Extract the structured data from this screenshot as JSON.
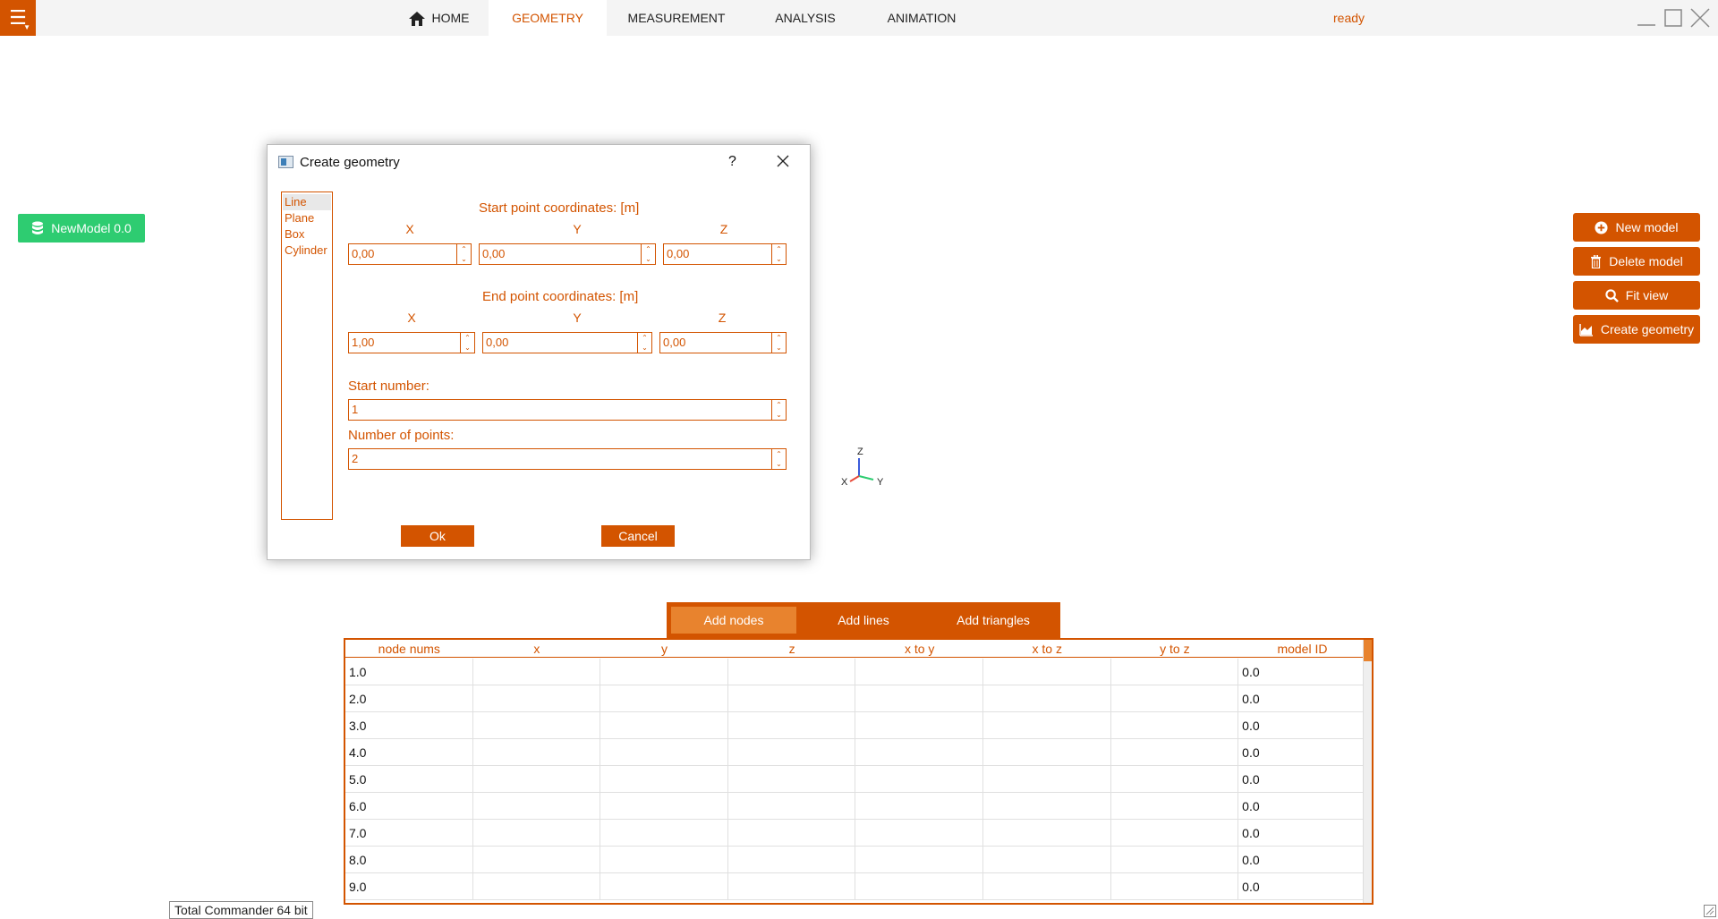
{
  "topbar": {
    "tabs": [
      {
        "label": "HOME"
      },
      {
        "label": "GEOMETRY"
      },
      {
        "label": "MEASUREMENT"
      },
      {
        "label": "ANALYSIS"
      },
      {
        "label": "ANIMATION"
      }
    ],
    "active_tab": "GEOMETRY",
    "status": "ready"
  },
  "model_chip": {
    "label": "NewModel 0.0",
    "color": "#2ecc71"
  },
  "side_buttons": {
    "new_model": "New model",
    "delete_model": "Delete model",
    "fit_view": "Fit view",
    "create_geometry": "Create geometry"
  },
  "dialog": {
    "title": "Create geometry",
    "help": "?",
    "shapes": [
      "Line",
      "Plane",
      "Box",
      "Cylinder"
    ],
    "selected_shape": "Line",
    "start_title": "Start point coordinates: [m]",
    "end_title": "End point coordinates: [m]",
    "axes": [
      "X",
      "Y",
      "Z"
    ],
    "start": {
      "x": "0,00",
      "y": "0,00",
      "z": "0,00"
    },
    "end": {
      "x": "1,00",
      "y": "0,00",
      "z": "0,00"
    },
    "start_number_label": "Start number:",
    "start_number": "1",
    "num_points_label": "Number of points:",
    "num_points": "2",
    "ok": "Ok",
    "cancel": "Cancel"
  },
  "gizmo": {
    "z": "Z",
    "x": "X",
    "y": "Y"
  },
  "bottom_tabs": {
    "nodes": "Add nodes",
    "lines": "Add lines",
    "triangles": "Add triangles",
    "active": "Add nodes"
  },
  "table": {
    "columns": [
      "node nums",
      "x",
      "y",
      "z",
      "x to y",
      "x to z",
      "y to z",
      "model ID"
    ],
    "rows": [
      [
        "1.0",
        "",
        "",
        "",
        "",
        "",
        "",
        "0.0"
      ],
      [
        "2.0",
        "",
        "",
        "",
        "",
        "",
        "",
        "0.0"
      ],
      [
        "3.0",
        "",
        "",
        "",
        "",
        "",
        "",
        "0.0"
      ],
      [
        "4.0",
        "",
        "",
        "",
        "",
        "",
        "",
        "0.0"
      ],
      [
        "5.0",
        "",
        "",
        "",
        "",
        "",
        "",
        "0.0"
      ],
      [
        "6.0",
        "",
        "",
        "",
        "",
        "",
        "",
        "0.0"
      ],
      [
        "7.0",
        "",
        "",
        "",
        "",
        "",
        "",
        "0.0"
      ],
      [
        "8.0",
        "",
        "",
        "",
        "",
        "",
        "",
        "0.0"
      ],
      [
        "9.0",
        "",
        "",
        "",
        "",
        "",
        "",
        "0.0"
      ]
    ]
  },
  "taskbar_tip": "Total Commander 64 bit",
  "colors": {
    "accent": "#d35400",
    "accent_light": "#e8832e",
    "model_green": "#2ecc71"
  },
  "icons": [
    "menu-icon",
    "home-icon",
    "minimize-icon",
    "maximize-icon",
    "close-icon",
    "database-icon",
    "plus-circle-icon",
    "trash-icon",
    "search-icon",
    "chart-icon"
  ]
}
